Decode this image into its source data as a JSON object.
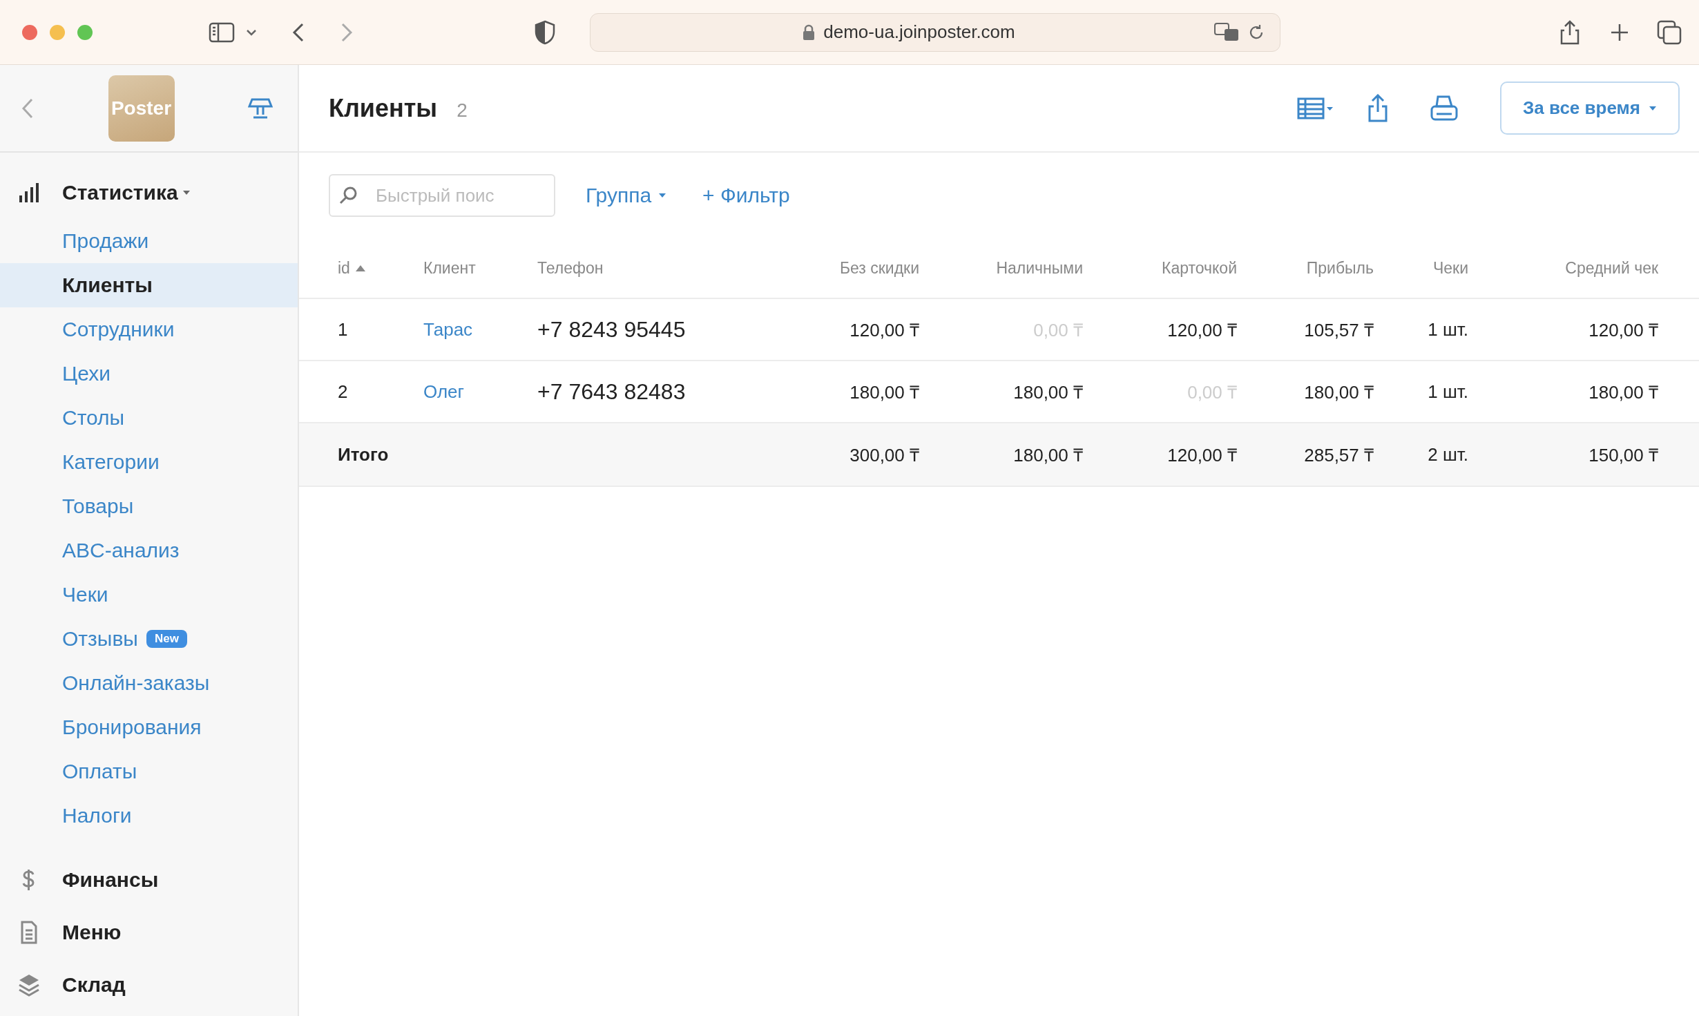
{
  "browser": {
    "url": "demo-ua.joinposter.com"
  },
  "sidebar": {
    "logo": "Poster",
    "sections": [
      {
        "label": "Статистика",
        "expanded": true,
        "children": [
          {
            "label": "Продажи",
            "selected": false
          },
          {
            "label": "Клиенты",
            "selected": true
          },
          {
            "label": "Сотрудники",
            "selected": false
          },
          {
            "label": "Цехи",
            "selected": false
          },
          {
            "label": "Столы",
            "selected": false
          },
          {
            "label": "Категории",
            "selected": false
          },
          {
            "label": "Товары",
            "selected": false
          },
          {
            "label": "ABC-анализ",
            "selected": false
          },
          {
            "label": "Чеки",
            "selected": false
          },
          {
            "label": "Отзывы",
            "selected": false,
            "badge": "New"
          },
          {
            "label": "Онлайн-заказы",
            "selected": false
          },
          {
            "label": "Бронирования",
            "selected": false
          },
          {
            "label": "Оплаты",
            "selected": false
          },
          {
            "label": "Налоги",
            "selected": false
          }
        ]
      },
      {
        "label": "Финансы",
        "expanded": false
      },
      {
        "label": "Меню",
        "expanded": false
      },
      {
        "label": "Склад",
        "expanded": false
      }
    ]
  },
  "header": {
    "title": "Клиенты",
    "count": "2",
    "period_button": "За все время"
  },
  "filters": {
    "search_placeholder": "Быстрый поис",
    "group": "Группа",
    "add_filter": "+ Фильтр"
  },
  "table": {
    "columns": [
      {
        "label": "id",
        "sorted": true
      },
      {
        "label": "Клиент",
        "sorted": false
      },
      {
        "label": "Телефон",
        "sorted": false
      },
      {
        "label": "Без скидки",
        "sorted": false
      },
      {
        "label": "Наличными",
        "sorted": false
      },
      {
        "label": "Карточкой",
        "sorted": false
      },
      {
        "label": "Прибыль",
        "sorted": false
      },
      {
        "label": "Чеки",
        "sorted": false
      },
      {
        "label": "Средний чек",
        "sorted": false
      }
    ],
    "rows": [
      {
        "id": "1",
        "client": "Тарас",
        "phone": "+7 8243 95445",
        "values": [
          {
            "text": "120,00 ₸",
            "muted": false
          },
          {
            "text": "0,00 ₸",
            "muted": true
          },
          {
            "text": "120,00 ₸",
            "muted": false
          },
          {
            "text": "105,57 ₸",
            "muted": false
          },
          {
            "text": "1 шт.",
            "muted": false
          },
          {
            "text": "120,00 ₸",
            "muted": false
          }
        ]
      },
      {
        "id": "2",
        "client": "Олег",
        "phone": "+7 7643 82483",
        "values": [
          {
            "text": "180,00 ₸",
            "muted": false
          },
          {
            "text": "180,00 ₸",
            "muted": false
          },
          {
            "text": "0,00 ₸",
            "muted": true
          },
          {
            "text": "180,00 ₸",
            "muted": false
          },
          {
            "text": "1 шт.",
            "muted": false
          },
          {
            "text": "180,00 ₸",
            "muted": false
          }
        ]
      }
    ],
    "total": {
      "label": "Итого",
      "values": [
        "300,00 ₸",
        "180,00 ₸",
        "120,00 ₸",
        "285,57 ₸",
        "2 шт.",
        "150,00 ₸"
      ]
    }
  }
}
